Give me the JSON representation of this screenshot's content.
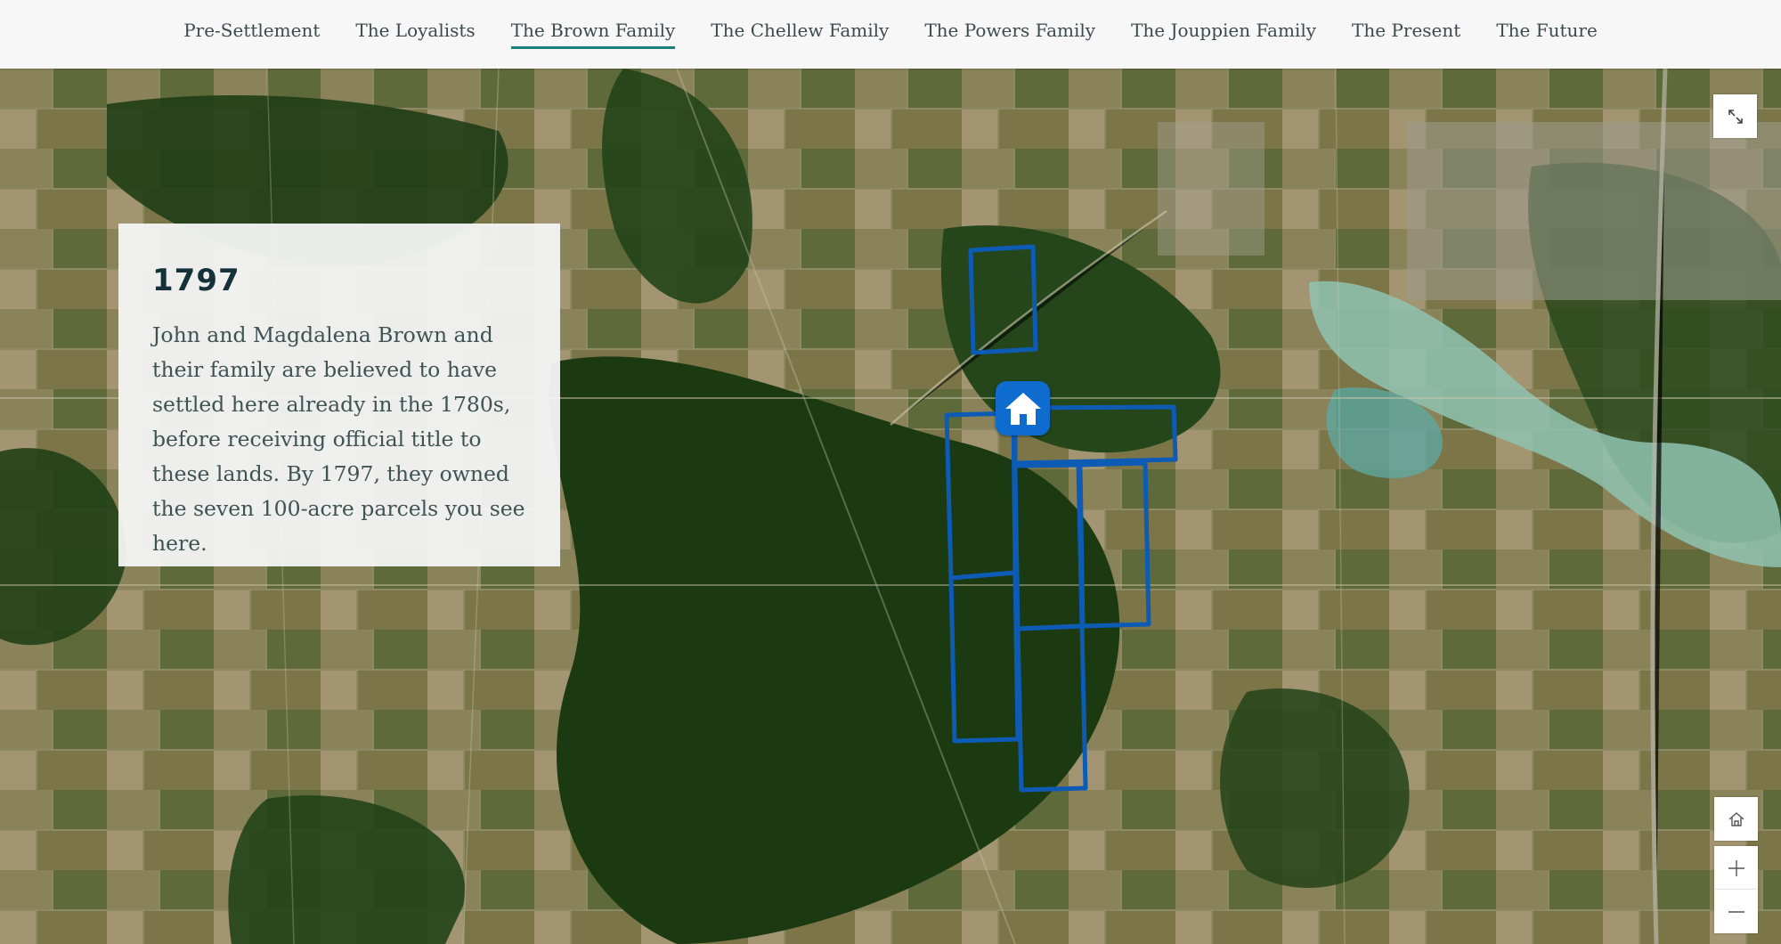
{
  "nav": {
    "items": [
      {
        "label": "Pre-Settlement"
      },
      {
        "label": "The Loyalists"
      },
      {
        "label": "The Brown Family",
        "active": true
      },
      {
        "label": "The Chellew Family"
      },
      {
        "label": "The Powers Family"
      },
      {
        "label": "The Jouppien Family"
      },
      {
        "label": "The Present"
      },
      {
        "label": "The Future"
      }
    ]
  },
  "card": {
    "year": "1797",
    "text": "John and Magdalena Brown and their family are believed to have settled here already in the 1780s, before receiving official title to these lands. By 1797, they owned the seven 100-acre parcels you see here."
  },
  "map": {
    "marker_icon": "home-icon",
    "parcel_color": "#0d5bb5",
    "controls": {
      "expand_icon": "expand-icon",
      "home_icon": "home-icon",
      "zoom_in_icon": "plus-icon",
      "zoom_out_icon": "minus-icon"
    }
  }
}
